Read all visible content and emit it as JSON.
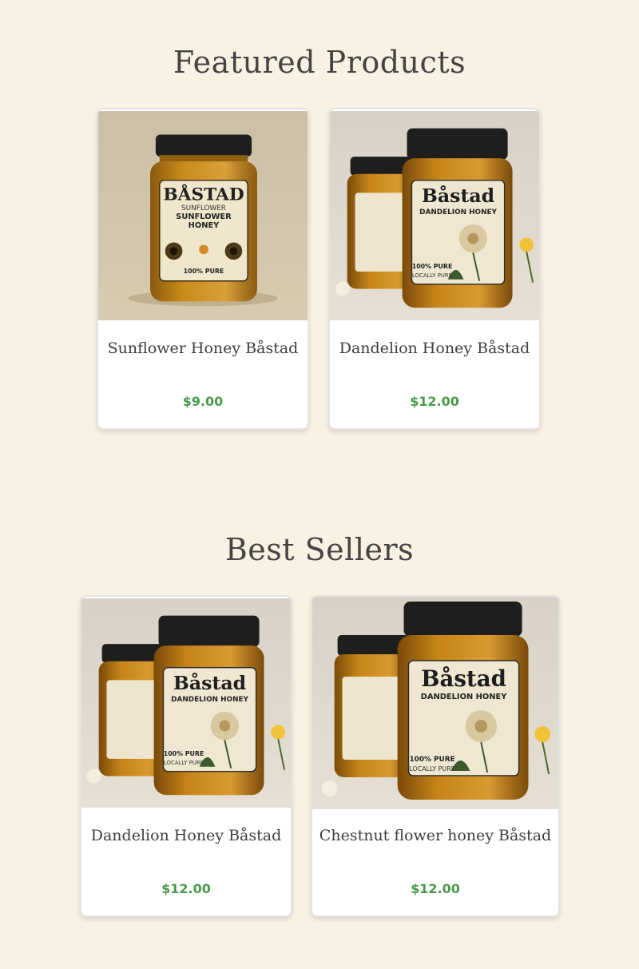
{
  "sections": {
    "featured": {
      "title": "Featured Products",
      "products": [
        {
          "name": "Sunflower Honey Båstad",
          "price": "$9.00",
          "image": "sunflower-honey-jar",
          "label_brand": "BÅSTAD",
          "label_sub1": "SUNFLOWER",
          "label_sub2": "SUNFLOWER",
          "label_sub3": "HONEY",
          "label_pure": "100% PURE"
        },
        {
          "name": "Dandelion Honey Båstad",
          "price": "$12.00",
          "image": "dandelion-honey-jars",
          "label_brand": "Båstad",
          "label_sub1": "DANDELION HONEY",
          "label_pure": "100% PURE",
          "label_local": "LOCALLY PURE"
        }
      ]
    },
    "best_sellers": {
      "title": "Best Sellers",
      "products": [
        {
          "name": "Dandelion Honey Båstad",
          "price": "$12.00",
          "image": "dandelion-honey-jars",
          "label_brand": "Båstad",
          "label_sub1": "DANDELION HONEY",
          "label_pure": "100% PURE",
          "label_local": "LOCALLY PURE"
        },
        {
          "name": "Chestnut flower honey Båstad",
          "price": "$12.00",
          "image": "dandelion-honey-jars",
          "label_brand": "Båstad",
          "label_sub1": "DANDELION HONEY",
          "label_pure": "100% PURE",
          "label_local": "LOCALLY PURE"
        }
      ]
    }
  },
  "colors": {
    "background": "#f9f1e2",
    "price": "#4a9a4a",
    "title": "#444444",
    "honey": "#c98a1a"
  }
}
